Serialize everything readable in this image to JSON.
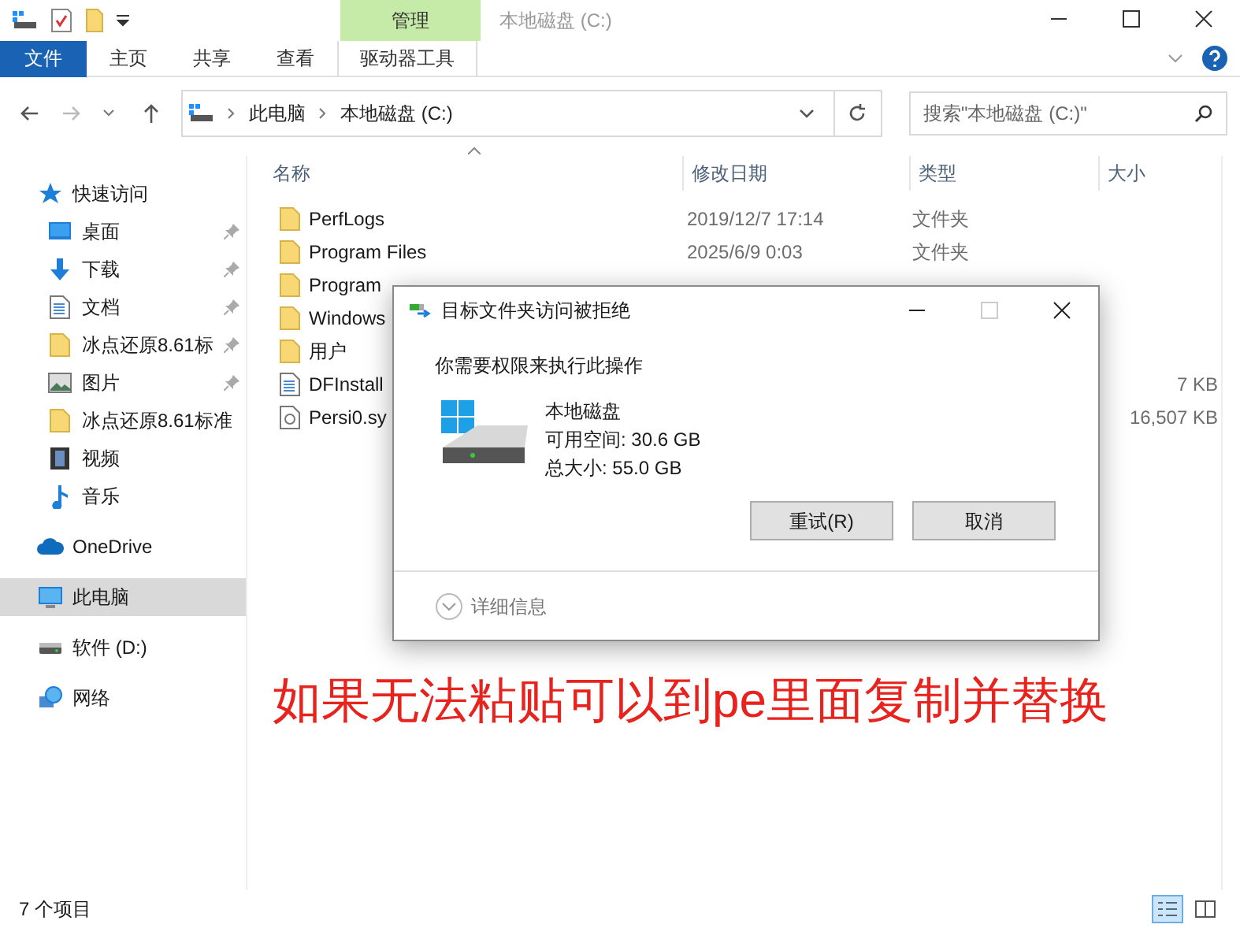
{
  "window": {
    "title": "本地磁盘 (C:)",
    "context_tab": "管理"
  },
  "ribbon_tabs": [
    {
      "label": "文件",
      "kind": "file"
    },
    {
      "label": "主页",
      "kind": "tab"
    },
    {
      "label": "共享",
      "kind": "tab"
    },
    {
      "label": "查看",
      "kind": "tab"
    },
    {
      "label": "驱动器工具",
      "kind": "context"
    }
  ],
  "address": {
    "crumbs": [
      "此电脑",
      "本地磁盘 (C:)"
    ]
  },
  "search": {
    "placeholder": "搜索\"本地磁盘 (C:)\""
  },
  "nav": [
    {
      "label": "快速访问",
      "kind": "star",
      "selected": false,
      "children": [
        {
          "label": "桌面",
          "kind": "desktop",
          "pinned": true,
          "selected": false
        },
        {
          "label": "下载",
          "kind": "download",
          "pinned": true,
          "selected": false
        },
        {
          "label": "文档",
          "kind": "document",
          "pinned": true,
          "selected": false
        },
        {
          "label": "冰点还原8.61标",
          "kind": "folder",
          "pinned": true,
          "selected": false
        },
        {
          "label": "图片",
          "kind": "picture",
          "pinned": true,
          "selected": false
        },
        {
          "label": "冰点还原8.61标准",
          "kind": "folder",
          "pinned": false,
          "selected": false
        },
        {
          "label": "视频",
          "kind": "video",
          "pinned": false,
          "selected": false
        },
        {
          "label": "音乐",
          "kind": "music",
          "pinned": false,
          "selected": false
        }
      ]
    },
    {
      "label": "OneDrive",
      "kind": "cloud",
      "selected": false
    },
    {
      "label": "此电脑",
      "kind": "pc",
      "selected": true
    },
    {
      "label": "软件 (D:)",
      "kind": "drive",
      "selected": false
    },
    {
      "label": "网络",
      "kind": "network",
      "selected": false
    }
  ],
  "columns": [
    "名称",
    "修改日期",
    "类型",
    "大小"
  ],
  "files": [
    {
      "kind": "folder",
      "name": "PerfLogs",
      "date": "2019/12/7 17:14",
      "type": "文件夹"
    },
    {
      "kind": "folder",
      "name": "Program Files",
      "date": "2025/6/9 0:03",
      "type": "文件夹"
    },
    {
      "kind": "folder",
      "name": "Program"
    },
    {
      "kind": "folder",
      "name": "Windows"
    },
    {
      "kind": "folder",
      "name": "用户"
    },
    {
      "kind": "document",
      "name": "DFInstall",
      "size": "7 KB"
    },
    {
      "kind": "system",
      "name": "Persi0.sy",
      "size": "16,507 KB"
    }
  ],
  "status_bar": {
    "count": "7 个项目"
  },
  "dialog": {
    "title": "目标文件夹访问被拒绝",
    "message": "你需要权限来执行此操作",
    "drive_name": "本地磁盘",
    "free": "可用空间: 30.6 GB",
    "total": "总大小: 55.0 GB",
    "buttons": [
      "重试(R)",
      "取消"
    ],
    "details": "详细信息"
  },
  "annotation": "如果无法粘贴可以到pe里面复制并替换"
}
